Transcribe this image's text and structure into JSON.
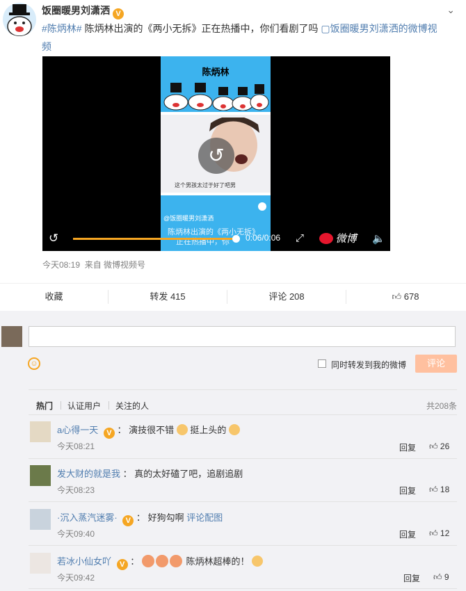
{
  "post": {
    "author": "饭圈暖男刘潇洒",
    "hashtag": "#陈炳林#",
    "text": " 陈炳林出演的《两小无拆》正在热播中，你们看剧了吗 ",
    "link": "饭圈暖男刘潇洒的微博视频",
    "time": "今天08:19",
    "source": "来自 微博视频号"
  },
  "video": {
    "overlay_title": "陈炳林",
    "subtitle_mid": "这个男孩太过于好了吧男",
    "watermark": "@饭圈暖男刘潇洒",
    "caption_bottom": "陈炳林出演的《两小无拆》",
    "caption_bottom2": "正在热播中，你",
    "timecode": "0:06/0:06",
    "progress": 1.0,
    "weibo_logo": "微博"
  },
  "actions": {
    "collect": "收藏",
    "repost": "转发 415",
    "comment": "评论 208",
    "like": "678"
  },
  "compose": {
    "emoji_icon": "☺",
    "checkbox_label": "同时转发到我的微博",
    "submit": "评论"
  },
  "filters": {
    "hot": "热门",
    "verified": "认证用户",
    "following": "关注的人",
    "total": "共208条"
  },
  "comments": [
    {
      "user": "a心得一天",
      "sep": "：",
      "text1": "演技很不错",
      "text2": "挺上头的",
      "time": "今天08:21",
      "reply": "回复",
      "likes": "26"
    },
    {
      "user": "发大财的就是我",
      "sep": "：",
      "text1": "真的太好磕了吧，追剧追剧",
      "time": "今天08:23",
      "reply": "回复",
      "likes": "18"
    },
    {
      "user": "·沉入蒸汽迷雾·",
      "sep": "：",
      "text1": "好狗勾啊",
      "pic_link": "评论配图",
      "time": "今天09:40",
      "reply": "回复",
      "likes": "12"
    },
    {
      "user": "若冰小仙女吖",
      "sep": "：",
      "text1": "陈炳林超棒的！",
      "time": "今天09:42",
      "reply": "回复",
      "likes": "9"
    }
  ],
  "colors": {
    "accent": "#f6a623",
    "link": "#507daf",
    "submit": "#ffc09f"
  }
}
